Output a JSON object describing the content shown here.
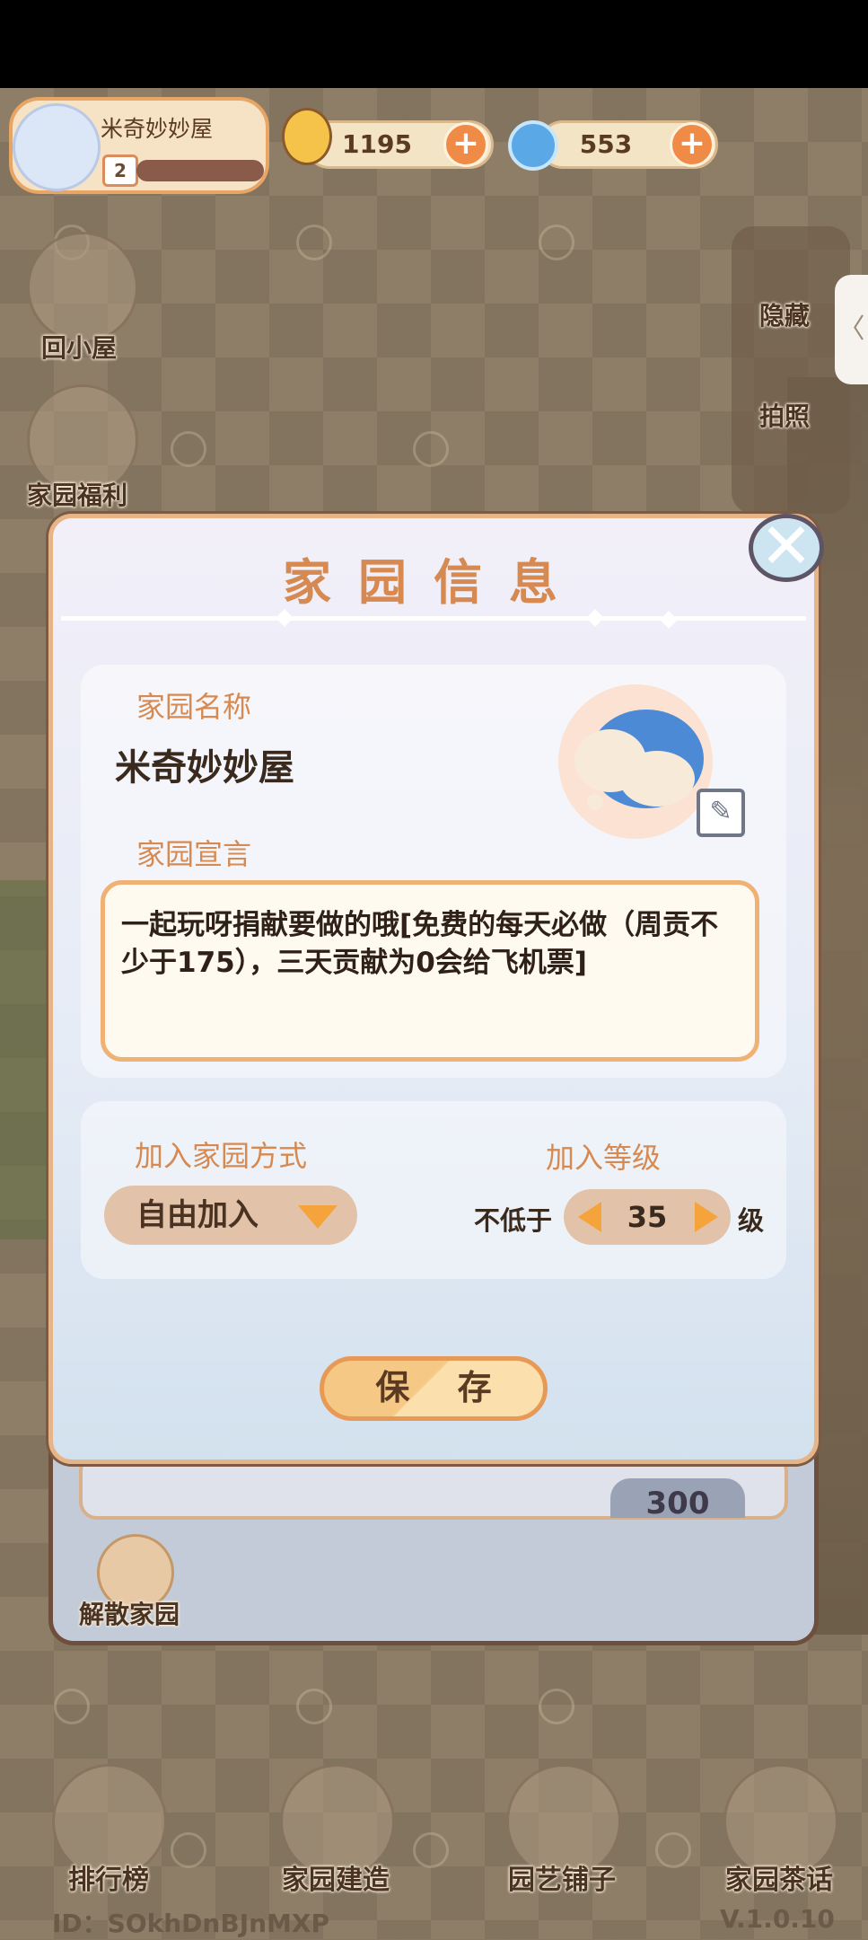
{
  "top_bar": {
    "home_name": "米奇妙妙屋",
    "home_level": "2",
    "snail_currency": "1195",
    "swirl_currency": "553"
  },
  "left_menu": {
    "back_home": "回小屋",
    "welfare": "家园福利"
  },
  "right_menu": {
    "hide": "隐藏",
    "photo": "拍照",
    "collapse_arrow": "〈"
  },
  "dialog": {
    "title": "家园信息",
    "name_label": "家园名称",
    "name_value": "米奇妙妙屋",
    "declaration_label": "家园宣言",
    "declaration_value": "一起玩呀捐献要做的哦[免费的每天必做（周贡不少于175），三天贡献为0会给飞机票]",
    "join_method_label": "加入家园方式",
    "join_method_value": "自由加入",
    "join_level_label": "加入等级",
    "level_prefix": "不低于",
    "level_value": "35",
    "level_suffix": "级",
    "save_label": "保 存",
    "close_symbol": "✕"
  },
  "under_panel": {
    "value": "300",
    "disband_label": "解散家园"
  },
  "bottom_nav": {
    "ranking": "排行榜",
    "build": "家园建造",
    "shop": "园艺铺子",
    "chat": "家园茶话"
  },
  "footer": {
    "id": "ID：SOkhDnBJnMXP",
    "version": "V.1.0.10"
  },
  "colors": {
    "accent_orange": "#d68a52",
    "button_orange": "#ef8a47",
    "dialog_border": "#e7b488"
  }
}
